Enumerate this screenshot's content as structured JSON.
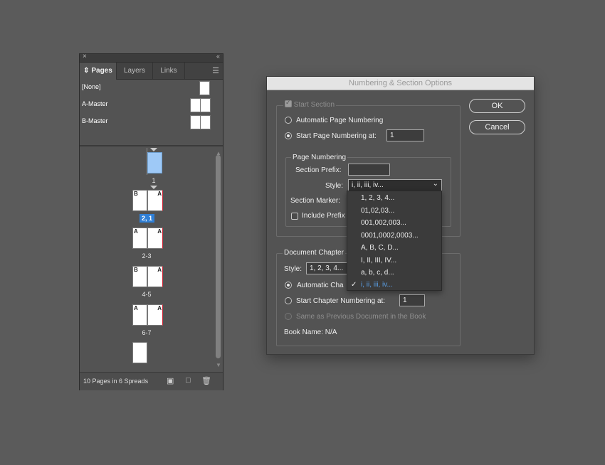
{
  "pages_panel": {
    "tabs": [
      "Pages",
      "Layers",
      "Links"
    ],
    "tab_pages_icon": "⇕",
    "masters": [
      "[None]",
      "A-Master",
      "B-Master"
    ],
    "spreads": [
      {
        "label": "1"
      },
      {
        "label": "2, 1",
        "left_letter": "B",
        "right_letter": "A"
      },
      {
        "label": "2-3",
        "left_letter": "A",
        "right_letter": "A"
      },
      {
        "label": "4-5",
        "left_letter": "B",
        "right_letter": "A"
      },
      {
        "label": "6-7",
        "left_letter": "A",
        "right_letter": "A"
      }
    ],
    "status": "10 Pages in 6 Spreads",
    "close_glyph": "×",
    "collapse_glyph": "‹‹"
  },
  "dialog": {
    "title": "Numbering & Section Options",
    "start_section": "Start Section",
    "automatic_page_numbering": "Automatic Page Numbering",
    "start_page_numbering_at": "Start Page Numbering at:",
    "start_page_value": "1",
    "page_numbering_group": "Page Numbering",
    "section_prefix_label": "Section Prefix:",
    "section_prefix_value": "",
    "style_label": "Style:",
    "style_value": "i, ii, iii, iv...",
    "section_marker_label": "Section Marker:",
    "include_prefix_label": "Include Prefix",
    "document_chapter_group": "Document Chapter",
    "chapter_style_label": "Style:",
    "chapter_style_value": "1, 2, 3, 4...",
    "automatic_chapter": "Automatic Cha",
    "start_chapter_numbering_at": "Start Chapter Numbering at:",
    "start_chapter_value": "1",
    "same_as_previous": "Same as Previous Document in the Book",
    "book_name": "Book Name: N/A",
    "ok_label": "OK",
    "cancel_label": "Cancel"
  },
  "style_menu": {
    "items": [
      "1, 2, 3, 4...",
      "01,02,03...",
      "001,002,003...",
      "0001,0002,0003...",
      "A, B, C, D...",
      "I, II, III, IV...",
      "a, b, c, d...",
      "i, ii, iii, iv..."
    ],
    "selected_index": 7,
    "check_glyph": "✓"
  },
  "colors": {
    "background": "#5b5b5b",
    "panel": "#535353",
    "selection_blue": "#2f7fd6",
    "menu_selected_text": "#5aa0e8",
    "page_thumb_selected": "#9ec9f7"
  }
}
